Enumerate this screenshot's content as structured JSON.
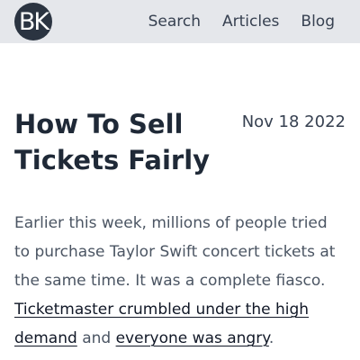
{
  "header": {
    "logo_text": "BK",
    "nav": [
      {
        "label": "Search"
      },
      {
        "label": "Articles"
      },
      {
        "label": "Blog"
      }
    ]
  },
  "article": {
    "title": "How To Sell Tickets Fairly",
    "date": "Nov 18 2022",
    "intro": "Earlier this week, millions of people tried to purchase Taylor Swift concert tickets at the same time. It was a complete fiasco.",
    "link_1": "Ticketmaster crumbled under the high demand",
    "conjunction": "and",
    "link_2": "everyone was angry",
    "ending": "."
  }
}
